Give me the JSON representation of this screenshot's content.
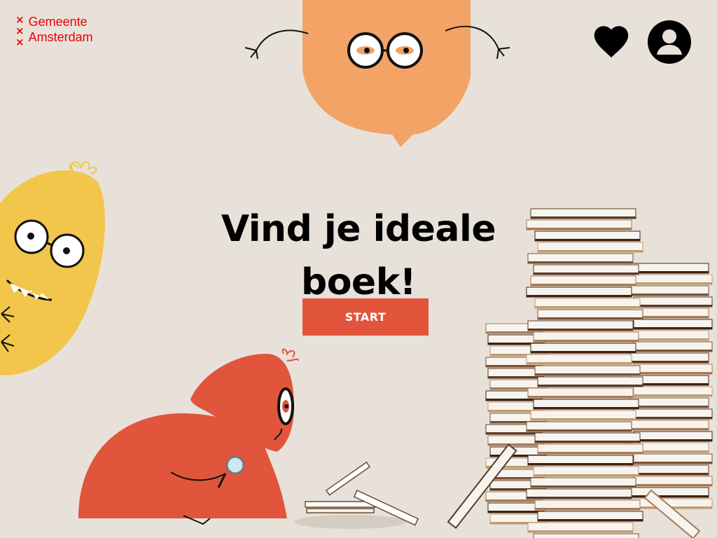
{
  "logo": {
    "line1": "Gemeente",
    "line2": "Amsterdam",
    "crosses": [
      "×",
      "×",
      "×"
    ],
    "color": "#ec0000"
  },
  "header": {
    "favorites_icon": "heart-icon",
    "account_icon": "user-circle-icon"
  },
  "hero": {
    "title": "Vind je ideale boek!",
    "start_label": "START"
  },
  "colors": {
    "background": "#e8e1da",
    "accent": "#e0553b",
    "orange_character": "#f2a365",
    "yellow_character": "#f1c64a",
    "red_character": "#e0553b"
  }
}
